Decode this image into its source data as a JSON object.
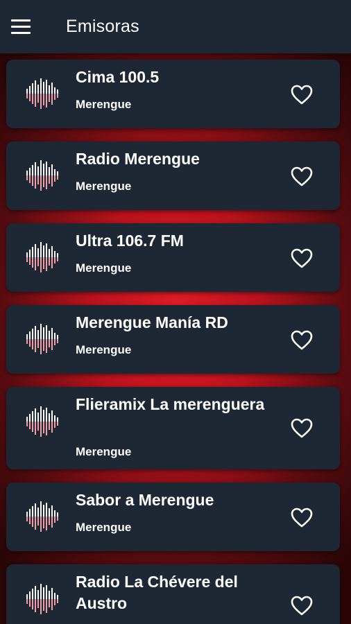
{
  "appbar": {
    "title": "Emisoras",
    "menu_icon": "hamburger-menu-icon"
  },
  "colors": {
    "appbar_bg": "#1d2834",
    "card_bg": "#1d2834",
    "accent_red": "#e01b26",
    "wave_pink": "#f2a0a6"
  },
  "stations": [
    {
      "name": "Cima 100.5",
      "genre": "Merengue",
      "favorite": false
    },
    {
      "name": "Radio Merengue",
      "genre": "Merengue",
      "favorite": false
    },
    {
      "name": "Ultra 106.7 FM",
      "genre": "Merengue",
      "favorite": false
    },
    {
      "name": "Merengue Manía RD",
      "genre": "Merengue",
      "favorite": false
    },
    {
      "name": "Flieramix La merenguera",
      "genre": "Merengue",
      "favorite": false
    },
    {
      "name": "Sabor a Merengue",
      "genre": "Merengue",
      "favorite": false
    },
    {
      "name": "Radio La Chévere del Austro",
      "genre": "",
      "favorite": false
    }
  ]
}
